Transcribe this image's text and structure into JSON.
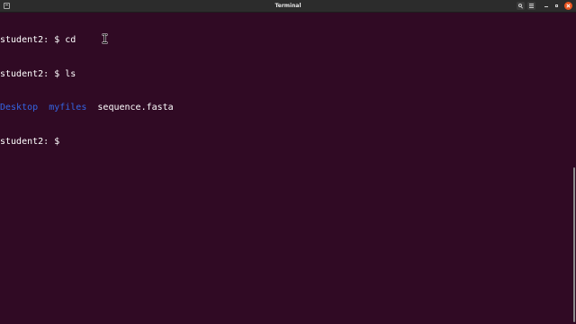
{
  "window": {
    "title": "Terminal"
  },
  "terminal": {
    "lines": [
      {
        "prompt": "student2: $ ",
        "command": "cd"
      },
      {
        "prompt": "student2: $ ",
        "command": "ls"
      }
    ],
    "ls_output": {
      "dir1": "Desktop",
      "dir2": "myfiles",
      "file1": "sequence.fasta"
    },
    "current_prompt": "student2: $ "
  },
  "colors": {
    "background": "#300a24",
    "directory": "#3465e4",
    "text": "#ffffff",
    "close_button": "#e9541f"
  },
  "icons": {
    "app_icon": "terminal-tab-icon",
    "search": "search-icon",
    "menu": "hamburger-menu-icon",
    "minimize": "minimize-icon",
    "maximize": "maximize-icon",
    "close": "close-icon"
  }
}
